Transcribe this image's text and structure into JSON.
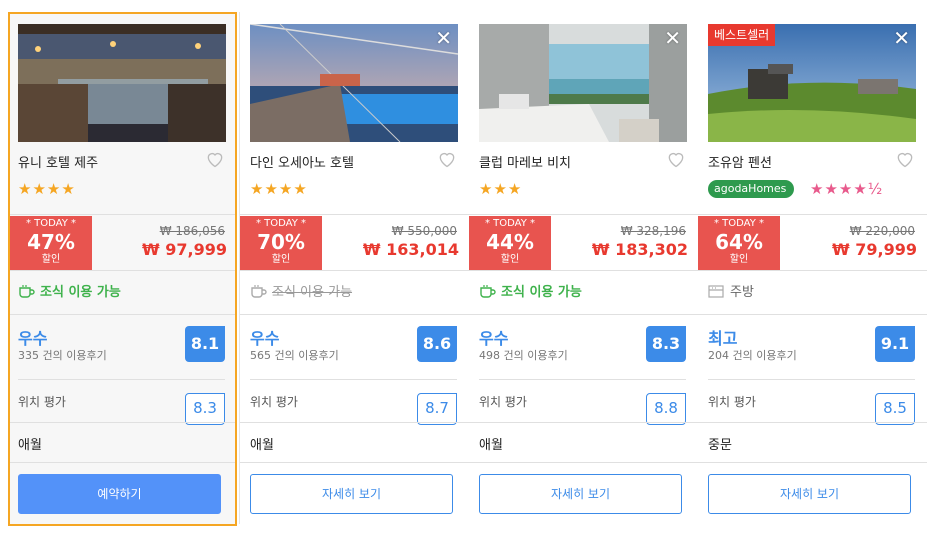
{
  "cards": [
    {
      "name": "유니 호텔 제주",
      "stars": "★★★★",
      "today": "* TODAY *",
      "discount": "47%",
      "sale_label": "할인",
      "old_price": "₩ 186,056",
      "new_price": "₩ 97,999",
      "amenity": "조식 이용 가능",
      "rating_word": "우수",
      "reviews": "335 건의 이용후기",
      "score": "8.1",
      "location_label": "위치 평가",
      "location_score": "8.3",
      "area": "애월",
      "button": "예약하기"
    },
    {
      "name": "다인 오세아노 호텔",
      "stars": "★★★★",
      "today": "* TODAY *",
      "discount": "70%",
      "sale_label": "할인",
      "old_price": "₩ 550,000",
      "new_price": "₩ 163,014",
      "amenity": "조식 이용 가능",
      "rating_word": "우수",
      "reviews": "565 건의 이용후기",
      "score": "8.6",
      "location_label": "위치 평가",
      "location_score": "8.7",
      "area": "애월",
      "button": "자세히 보기"
    },
    {
      "name": "클럽 마레보 비치",
      "stars": "★★★",
      "today": "* TODAY *",
      "discount": "44%",
      "sale_label": "할인",
      "old_price": "₩ 328,196",
      "new_price": "₩ 183,302",
      "amenity": "조식 이용 가능",
      "rating_word": "우수",
      "reviews": "498 건의 이용후기",
      "score": "8.3",
      "location_label": "위치 평가",
      "location_score": "8.8",
      "area": "애월",
      "button": "자세히 보기"
    },
    {
      "name": "조유암 펜션",
      "badge": "베스트셀러",
      "agoda_label": "agodaHomes",
      "stars": "★★★★½",
      "today": "* TODAY *",
      "discount": "64%",
      "sale_label": "할인",
      "old_price": "₩ 220,000",
      "new_price": "₩ 79,999",
      "amenity": "주방",
      "rating_word": "최고",
      "reviews": "204 건의 이용후기",
      "score": "9.1",
      "location_label": "위치 평가",
      "location_score": "8.5",
      "area": "중문",
      "button": "자세히 보기"
    }
  ],
  "colors": {
    "selected_border": "#f5a623",
    "deal_red": "#e8544f",
    "price_red": "#e8392f",
    "score_blue": "#3c8be8",
    "amenity_green": "#3fb24c",
    "star_orange": "#f5a623",
    "star_pink": "#e85a8c"
  },
  "icons": [
    "heart-outline-icon",
    "close-icon",
    "coffee-cup-icon",
    "kitchen-icon",
    "agoda-homes-logo"
  ]
}
